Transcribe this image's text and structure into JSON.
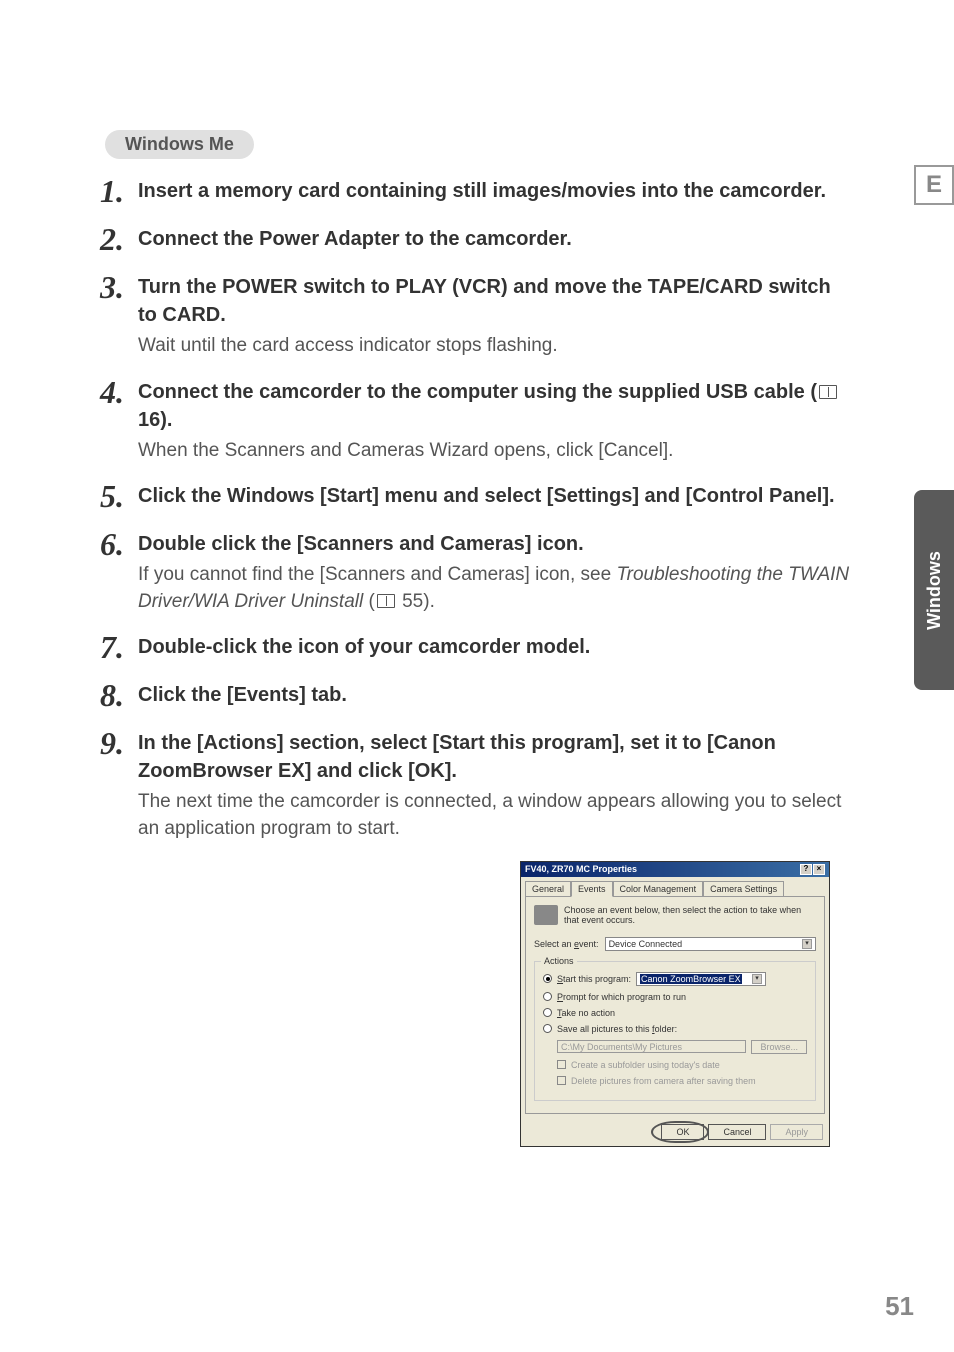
{
  "page": {
    "number": "51",
    "lang_badge": "E",
    "side_tab": "Windows"
  },
  "os_badge": "Windows Me",
  "steps": [
    {
      "num": "1",
      "title": "Insert a memory card containing still images/movies into the camcorder.",
      "sub": ""
    },
    {
      "num": "2",
      "title": "Connect the Power Adapter to the camcorder.",
      "sub": ""
    },
    {
      "num": "3",
      "title": "Turn the POWER switch to PLAY (VCR) and move the TAPE/CARD switch to CARD.",
      "sub": "Wait until the card access indicator stops flashing."
    },
    {
      "num": "4",
      "title_pre": "Connect the camcorder to the computer using the supplied USB cable (",
      "title_ref": "16).",
      "sub": "When the Scanners and Cameras Wizard opens, click [Cancel]."
    },
    {
      "num": "5",
      "title": "Click the Windows [Start] menu and select [Settings] and [Control Panel].",
      "sub": ""
    },
    {
      "num": "6",
      "title": "Double click the [Scanners and Cameras] icon.",
      "sub_pre": "If you cannot find the [Scanners and Cameras] icon, see ",
      "sub_italic": "Troubleshooting the TWAIN Driver/WIA Driver Uninstall",
      "sub_post": " (",
      "sub_ref": "55)."
    },
    {
      "num": "7",
      "title": "Double-click the icon of your camcorder model.",
      "sub": ""
    },
    {
      "num": "8",
      "title": "Click the [Events] tab.",
      "sub": ""
    },
    {
      "num": "9",
      "title": "In the [Actions] section, select [Start this program], set it to [Canon ZoomBrowser EX] and click [OK].",
      "sub": "The next time the camcorder is connected, a window appears allowing you to select an application program to start."
    }
  ],
  "dialog": {
    "title": "FV40, ZR70 MC Properties",
    "tabs": [
      "General",
      "Events",
      "Color Management",
      "Camera Settings"
    ],
    "active_tab": "Events",
    "instruction": "Choose an event below, then select the action to take when that event occurs.",
    "select_event_label": "Select an event:",
    "select_event_value": "Device Connected",
    "actions_group": "Actions",
    "radios": {
      "start_program": "Start this program:",
      "start_program_value": "Canon ZoomBrowser EX",
      "prompt": "Prompt for which program to run",
      "take_no_action": "Take no action",
      "save_all": "Save all pictures to this folder:"
    },
    "folder_path": "C:\\My Documents\\My Pictures",
    "browse": "Browse...",
    "checkboxes": {
      "subfolder": "Create a subfolder using today's date",
      "delete": "Delete pictures from camera after saving them"
    },
    "buttons": {
      "ok": "OK",
      "cancel": "Cancel",
      "apply": "Apply"
    }
  }
}
